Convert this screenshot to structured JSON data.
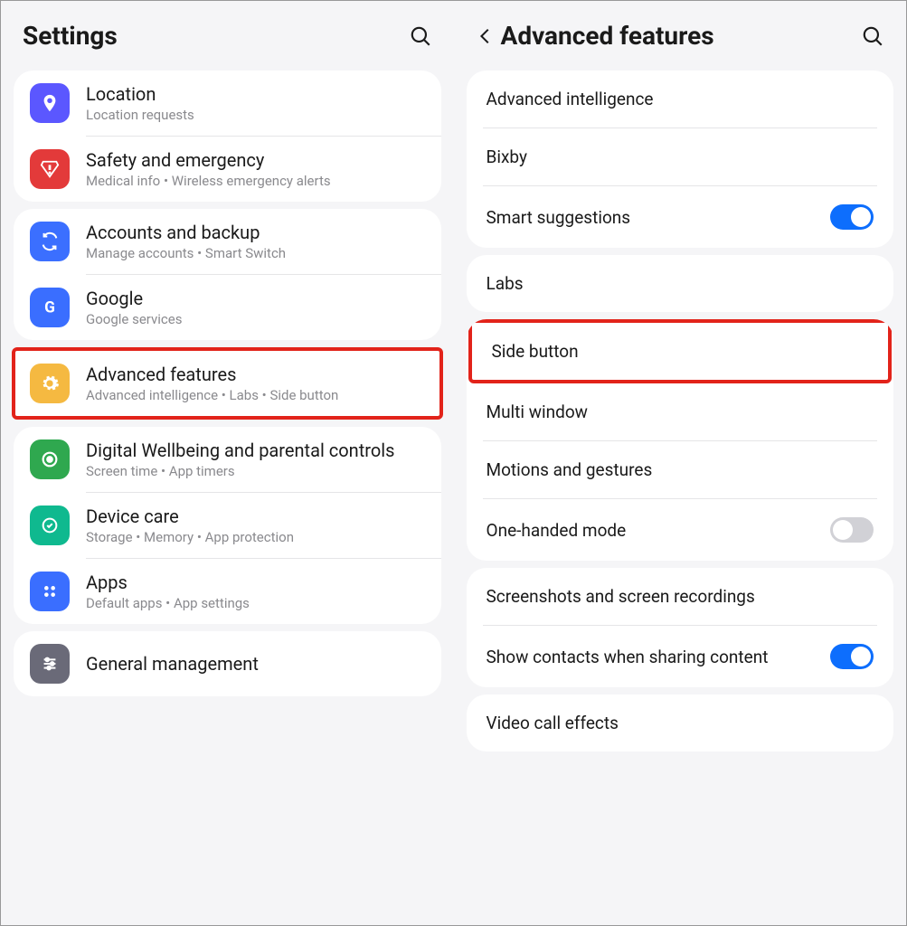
{
  "left": {
    "title": "Settings",
    "groups": [
      [
        {
          "title": "Location",
          "sub": "Location requests",
          "icon": "location",
          "bg": "#5b57ff"
        },
        {
          "title": "Safety and emergency",
          "sub": "Medical info  •  Wireless emergency alerts",
          "icon": "alert",
          "bg": "#e33a3a"
        }
      ],
      [
        {
          "title": "Accounts and backup",
          "sub": "Manage accounts  •  Smart Switch",
          "icon": "sync",
          "bg": "#3b6fff"
        },
        {
          "title": "Google",
          "sub": "Google services",
          "icon": "google",
          "bg": "#3a6eff"
        }
      ],
      [
        {
          "title": "Advanced features",
          "sub": "Advanced intelligence  •  Labs  •  Side button",
          "icon": "gear",
          "bg": "#f5b941",
          "highlight": true
        }
      ],
      [
        {
          "title": "Digital Wellbeing and parental controls",
          "sub": "Screen time  •  App timers",
          "icon": "wellbeing",
          "bg": "#2fa84f"
        },
        {
          "title": "Device care",
          "sub": "Storage  •  Memory  •  App protection",
          "icon": "care",
          "bg": "#0fb98f"
        },
        {
          "title": "Apps",
          "sub": "Default apps  •  App settings",
          "icon": "apps",
          "bg": "#3a6eff"
        }
      ],
      [
        {
          "title": "General management",
          "sub": "",
          "icon": "sliders",
          "bg": "#6a6a78"
        }
      ]
    ]
  },
  "right": {
    "title": "Advanced features",
    "groups": [
      [
        {
          "title": "Advanced intelligence"
        },
        {
          "title": "Bixby"
        },
        {
          "title": "Smart suggestions",
          "toggle": "on"
        }
      ],
      [
        {
          "title": "Labs"
        }
      ],
      [
        {
          "title": "Side button",
          "highlight": true
        },
        {
          "title": "Multi window"
        },
        {
          "title": "Motions and gestures"
        },
        {
          "title": "One-handed mode",
          "toggle": "off"
        }
      ],
      [
        {
          "title": "Screenshots and screen recordings"
        },
        {
          "title": "Show contacts when sharing content",
          "toggle": "on"
        }
      ],
      [
        {
          "title": "Video call effects"
        }
      ]
    ]
  }
}
